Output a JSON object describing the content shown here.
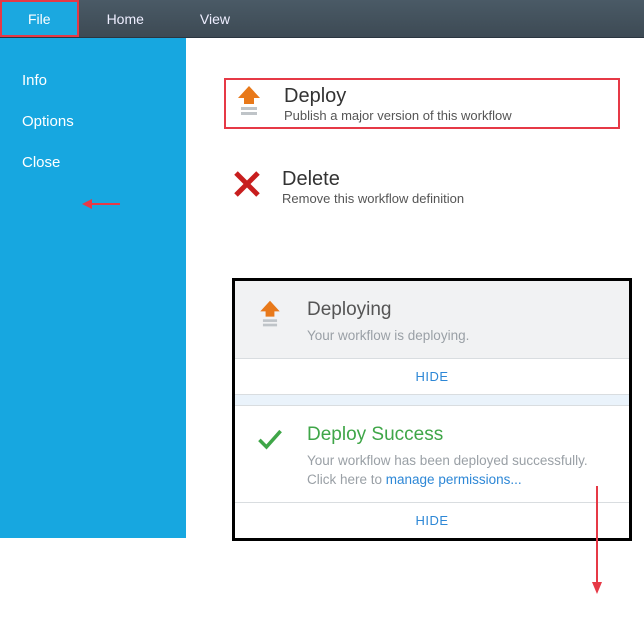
{
  "topbar": {
    "tabs": [
      "File",
      "Home",
      "View"
    ],
    "active": 0
  },
  "sidebar": {
    "items": [
      "Info",
      "Options",
      "Close"
    ]
  },
  "actions": {
    "deploy": {
      "title": "Deploy",
      "sub": "Publish a major version of this workflow"
    },
    "delete": {
      "title": "Delete",
      "sub": "Remove this workflow definition"
    }
  },
  "panel": {
    "deploying": {
      "title": "Deploying",
      "msg": "Your workflow is deploying."
    },
    "success": {
      "title": "Deploy Success",
      "msg_prefix": "Your workflow has been deployed successfully. Click here to ",
      "link": "manage permissions..."
    },
    "hide_label": "HIDE"
  }
}
